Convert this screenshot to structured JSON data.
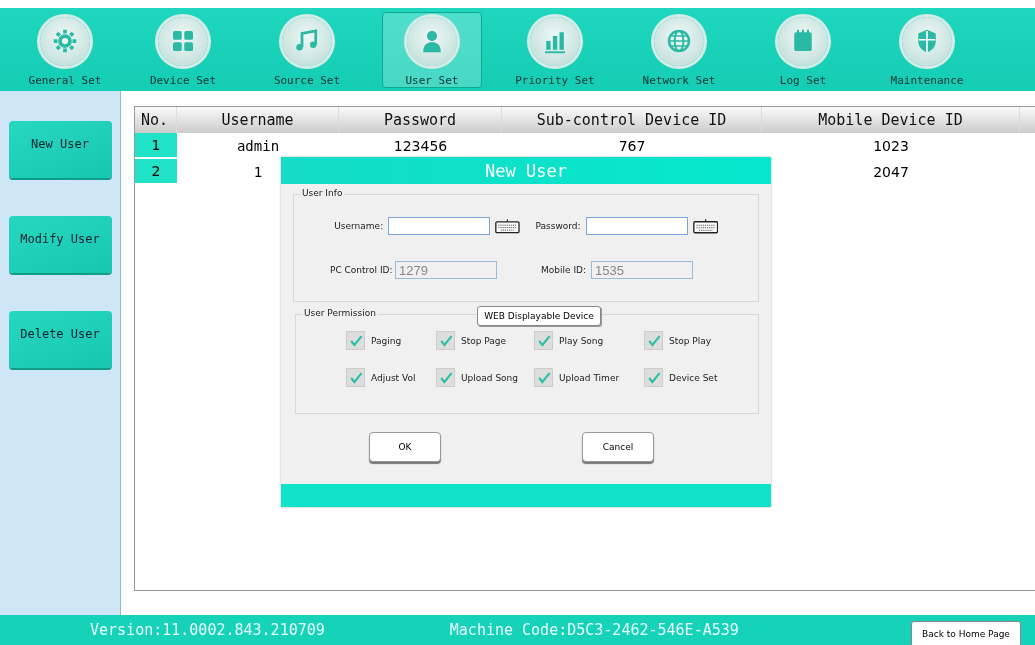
{
  "nav": [
    {
      "label": "General Set",
      "selected": false
    },
    {
      "label": "Device Set",
      "selected": false
    },
    {
      "label": "Source Set",
      "selected": false
    },
    {
      "label": "User Set",
      "selected": true
    },
    {
      "label": "Priority Set",
      "selected": false
    },
    {
      "label": "Network Set",
      "selected": false
    },
    {
      "label": "Log Set",
      "selected": false
    },
    {
      "label": "Maintenance",
      "selected": false
    }
  ],
  "sidebar": [
    "New User",
    "Modify User",
    "Delete User"
  ],
  "table": {
    "columns": [
      "No.",
      "Username",
      "Password",
      "Sub-control Device ID",
      "Mobile Device ID"
    ],
    "rows": [
      {
        "cells": [
          "1",
          "admin",
          "123456",
          "767",
          "1023"
        ]
      },
      {
        "cells": [
          "2",
          "1",
          null,
          null,
          "2047"
        ]
      }
    ]
  },
  "dialog": {
    "title": "New User",
    "user_info": {
      "legend": "User Info",
      "fields": [
        {
          "label": "Username:",
          "disabled": false,
          "keyboard": true
        },
        {
          "label": "Password:",
          "disabled": false,
          "keyboard": true
        },
        {
          "label": "PC Control ID:",
          "value": "1279",
          "disabled": true,
          "keyboard": false
        },
        {
          "label": "Mobile ID:",
          "value": "1535",
          "disabled": true,
          "keyboard": false
        }
      ]
    },
    "web_button": "WEB Displayable Device",
    "permissions": {
      "legend": "User Permission",
      "items": [
        {
          "label": "Paging",
          "checked": true
        },
        {
          "label": "Stop Page",
          "checked": true
        },
        {
          "label": "Play Song",
          "checked": true
        },
        {
          "label": "Stop Play",
          "checked": true
        },
        {
          "label": "Adjust Vol",
          "checked": true
        },
        {
          "label": "Upload Song",
          "checked": true
        },
        {
          "label": "Upload Timer",
          "checked": true
        },
        {
          "label": "Device Set",
          "checked": true
        }
      ]
    },
    "buttons": [
      "OK",
      "Cancel"
    ]
  },
  "status_bar": {
    "version": "Version:11.0002.843.210709",
    "machine_code": "Machine Code:D5C3-2462-546E-A539",
    "home_button": "Back to Home Page"
  }
}
